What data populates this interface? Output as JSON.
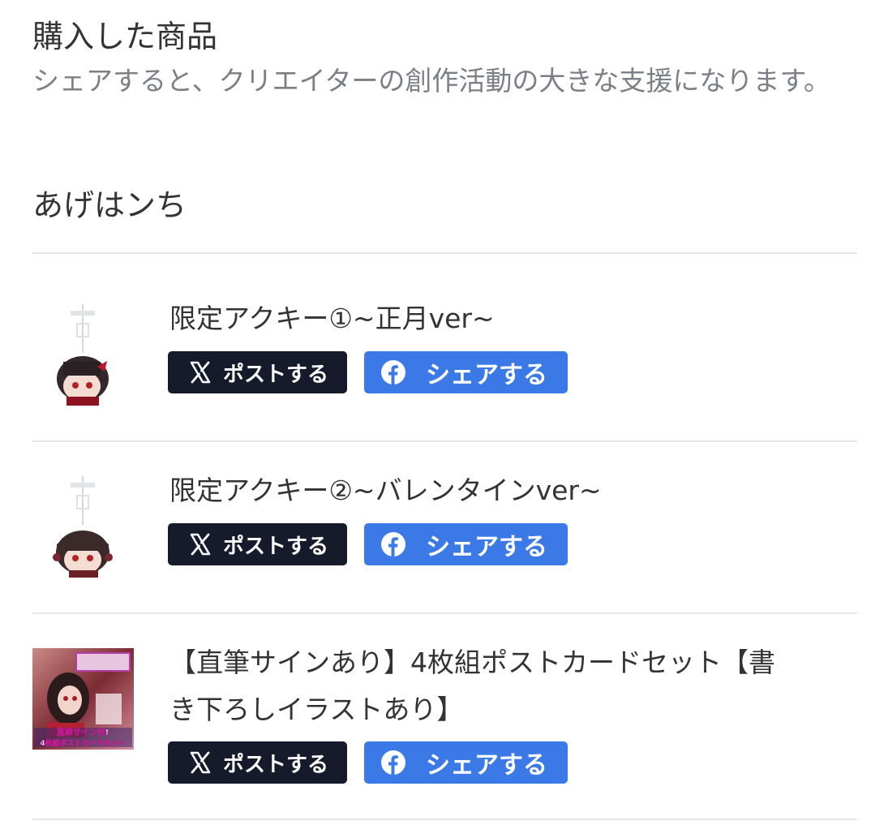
{
  "section": {
    "title": "購入した商品",
    "description": "シェアすると、クリエイターの創作活動の大きな支援になります。"
  },
  "creator": {
    "name": "あげはンち"
  },
  "colors": {
    "x_button": "#151b2a",
    "facebook_button": "#3b79e6",
    "divider": "#e6e6e6",
    "muted_text": "#7b7f86"
  },
  "items": [
    {
      "title": "限定アクキー①~正月ver~",
      "thumbnail": "acrylic-keychain-image",
      "post_label": "ポストする",
      "share_label": "シェアする"
    },
    {
      "title": "限定アクキー②~バレンタインver~",
      "thumbnail": "acrylic-keychain-image",
      "post_label": "ポストする",
      "share_label": "シェアする"
    },
    {
      "title_line1": "【直筆サインあり】4枚組ポストカードセット【書",
      "title_line2": "き下ろしイラストあり】",
      "thumbnail": "postcard-set-image",
      "thumbnail_lines": [
        "直筆サイン付!",
        "4枚組ポストカードセット"
      ],
      "post_label": "ポストする",
      "share_label": "シェアする"
    }
  ]
}
